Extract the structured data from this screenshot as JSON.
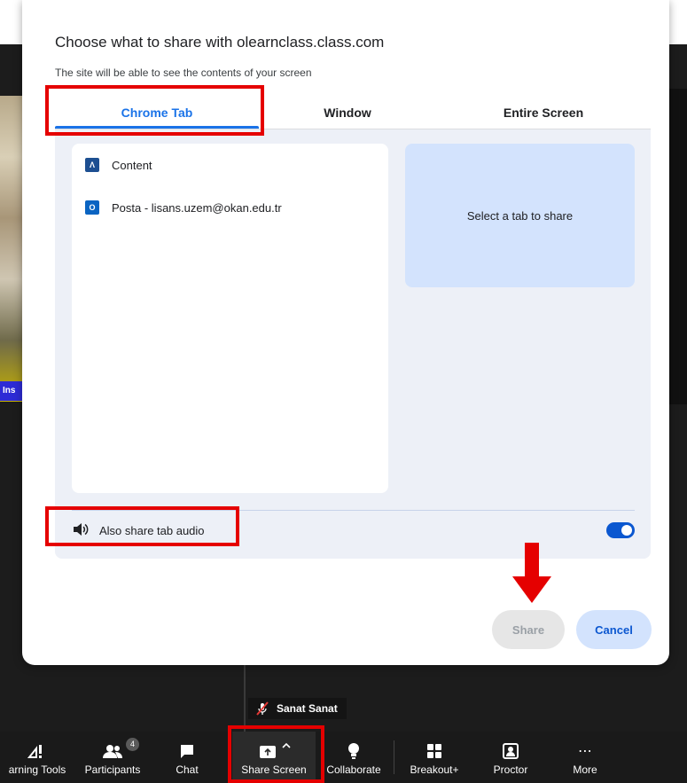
{
  "dialog": {
    "title": "Choose what to share with olearnclass.class.com",
    "subtitle": "The site will be able to see the contents of your screen",
    "tabs": [
      {
        "label": "Chrome Tab",
        "active": true
      },
      {
        "label": "Window",
        "active": false
      },
      {
        "label": "Entire Screen",
        "active": false
      }
    ],
    "items": [
      {
        "label": "Content",
        "favicon": "content-favicon-icon"
      },
      {
        "label": "Posta - lisans.uzem@okan.edu.tr",
        "favicon": "outlook-icon"
      }
    ],
    "preview_text": "Select a tab to share",
    "audio_label": "Also share tab audio",
    "audio_enabled": true,
    "share_label": "Share",
    "cancel_label": "Cancel"
  },
  "meeting": {
    "participant_name": "Sanat Sanat",
    "video_label": "Ins"
  },
  "toolbar": {
    "learning_tools": "arning Tools",
    "participants": "Participants",
    "participants_count": "4",
    "chat": "Chat",
    "share_screen": "Share Screen",
    "collaborate": "Collaborate",
    "breakout": "Breakout+",
    "proctor": "Proctor",
    "more": "More"
  },
  "colors": {
    "accent": "#1a73e8",
    "annotation": "#e50000",
    "preview_bg": "#d3e3fd"
  }
}
